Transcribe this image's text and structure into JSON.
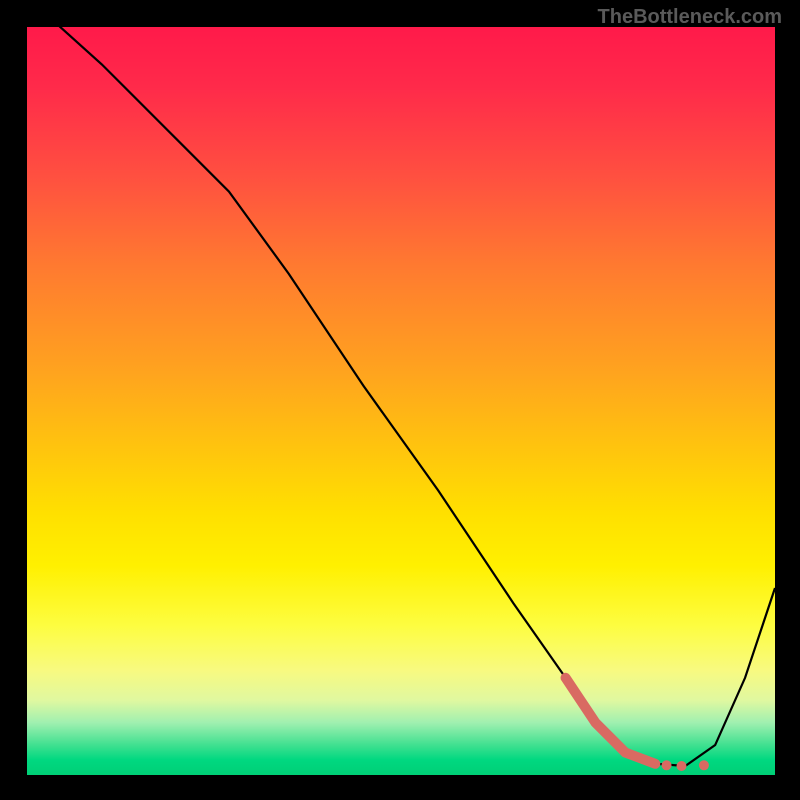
{
  "watermark": "TheBottleneck.com",
  "chart_data": {
    "type": "line",
    "title": "",
    "xlabel": "",
    "ylabel": "",
    "xlim": [
      0,
      100
    ],
    "ylim": [
      0,
      100
    ],
    "series": [
      {
        "name": "curve",
        "x": [
          0,
          10,
          20,
          27,
          35,
          45,
          55,
          65,
          72,
          76,
          80,
          84,
          88,
          92,
          96,
          100
        ],
        "y": [
          104,
          95,
          85,
          78,
          67,
          52,
          38,
          23,
          13,
          7,
          3,
          1.5,
          1.2,
          4,
          13,
          25
        ]
      }
    ],
    "highlight_segment": {
      "x": [
        72,
        76,
        80,
        84
      ],
      "y": [
        13,
        7,
        3,
        1.5
      ]
    },
    "highlight_dots": {
      "x": [
        85.5,
        87.5,
        90.5
      ],
      "y": [
        1.3,
        1.2,
        1.3
      ]
    },
    "background": "rainbow-vertical-gradient"
  }
}
